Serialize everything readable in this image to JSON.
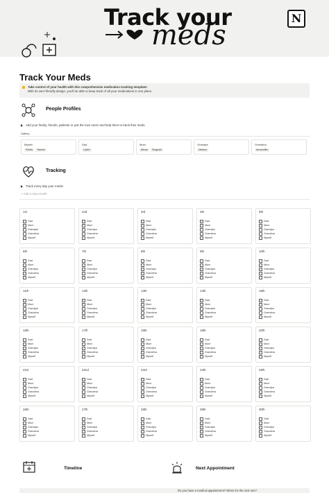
{
  "banner": {
    "title": "Track your",
    "script": "meds"
  },
  "page": {
    "title": "Track Your Meds"
  },
  "callout": {
    "line1": "Take control of your health with this comprehensive medication tracking template!",
    "line2": "With its user-friendly design, you'll be able to keep track of all your medications in one place."
  },
  "profiles": {
    "title": "People Profiles",
    "toggle": "Add your family, friends, patients or just the love ones! and help them to track their meds.",
    "tab": "Gallery",
    "cards": [
      {
        "name": "Myself",
        "tags": [
          "Pleats",
          "Yasmin"
        ]
      },
      {
        "name": "Dad",
        "tags": [
          "Lipitor"
        ]
      },
      {
        "name": "Mum",
        "tags": [
          "Ativan",
          "Singulair"
        ]
      },
      {
        "name": "Grandpa",
        "tags": [
          "Nexium"
        ]
      },
      {
        "name": "Grandma",
        "tags": [
          "Amoxicillin"
        ]
      }
    ]
  },
  "tracking": {
    "title": "Tracking",
    "toggle": "Track every day your meds!",
    "add": "+ Add a new month",
    "people": [
      "Dad",
      "Mum",
      "Grandpa",
      "Grandma",
      "Myself"
    ],
    "days": [
      "1st",
      "2nd",
      "3rd",
      "4th",
      "5th",
      "6th",
      "7th",
      "8th",
      "9th",
      "10th",
      "11th",
      "12th",
      "13th",
      "14th",
      "15th",
      "16th",
      "17th",
      "18th",
      "19th",
      "20th",
      "21st",
      "22nd",
      "23rd",
      "24th",
      "25th",
      "26th",
      "27th",
      "28th",
      "29th",
      "30th"
    ]
  },
  "bottom": {
    "timeline": "Timeline",
    "next": "Next Appointment",
    "question": "Do you have a medical appointment? When it's the next one?"
  }
}
